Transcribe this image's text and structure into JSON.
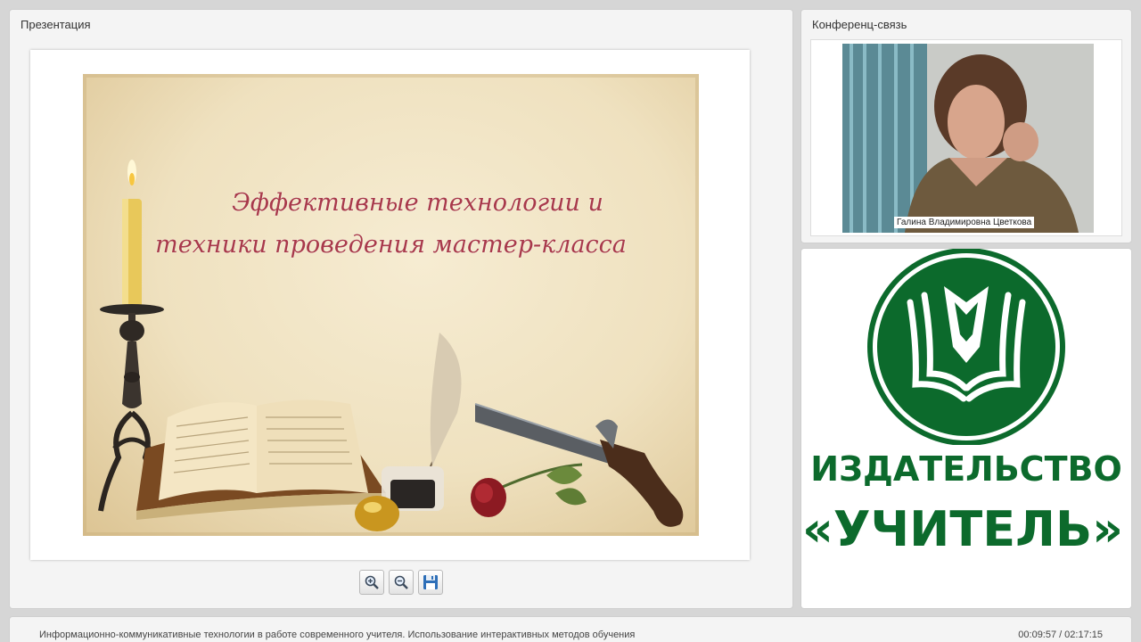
{
  "presentation": {
    "title": "Презентация",
    "slide": {
      "title_line1": "Эффективные технологии и",
      "title_line2": "техники проведения мастер-класса"
    },
    "toolbar": [
      {
        "name": "zoom-in",
        "icon": "zoom-in-icon"
      },
      {
        "name": "zoom-out",
        "icon": "zoom-out-icon"
      },
      {
        "name": "save",
        "icon": "floppy-disk-icon"
      }
    ]
  },
  "conference": {
    "title": "Конференц-связь",
    "participant_name": "Галина Владимировна Цветкова"
  },
  "logo": {
    "line1": "ИЗДАТЕЛЬСТВО",
    "line2": "«УЧИТЕЛЬ»",
    "color": "#0c6a2c"
  },
  "footer": {
    "course_title": "Информационно-коммуникативные технологии в работе современного учителя. Использование интерактивных методов обучения",
    "time_current": "00:09:57",
    "time_separator": "/",
    "time_total": "02:17:15"
  }
}
